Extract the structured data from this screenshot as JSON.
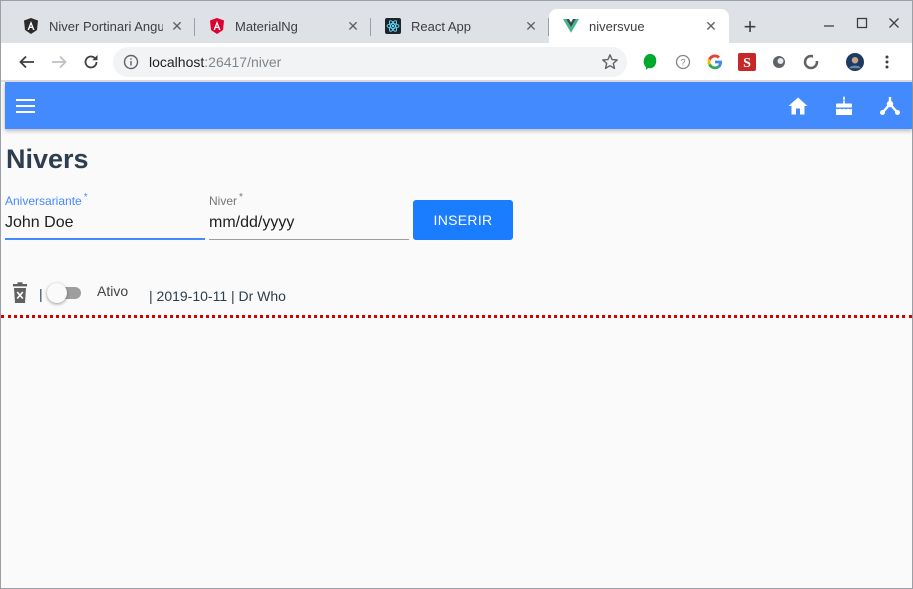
{
  "browser": {
    "tabs": [
      {
        "title": "Niver Portinari Angu",
        "favicon": "angular-black-icon"
      },
      {
        "title": "MaterialNg",
        "favicon": "angular-red-icon"
      },
      {
        "title": "React App",
        "favicon": "react-icon"
      },
      {
        "title": "niversvue",
        "favicon": "vue-icon",
        "active": true
      }
    ],
    "new_tab": "+",
    "url_host": "localhost",
    "url_rest": ":26417/niver"
  },
  "app": {
    "accent": "#448aff",
    "heading": "Nivers",
    "form": {
      "name_label": "Aniversariante",
      "name_value": "John Doe",
      "date_label": "Niver",
      "date_value": "mm/dd/yyyy",
      "required_mark": "*",
      "insert_label": "INSERIR"
    },
    "rows": [
      {
        "separator": "|",
        "switch_label": "Ativo",
        "text": "| 2019-10-11 | Dr Who",
        "active": false
      }
    ]
  }
}
